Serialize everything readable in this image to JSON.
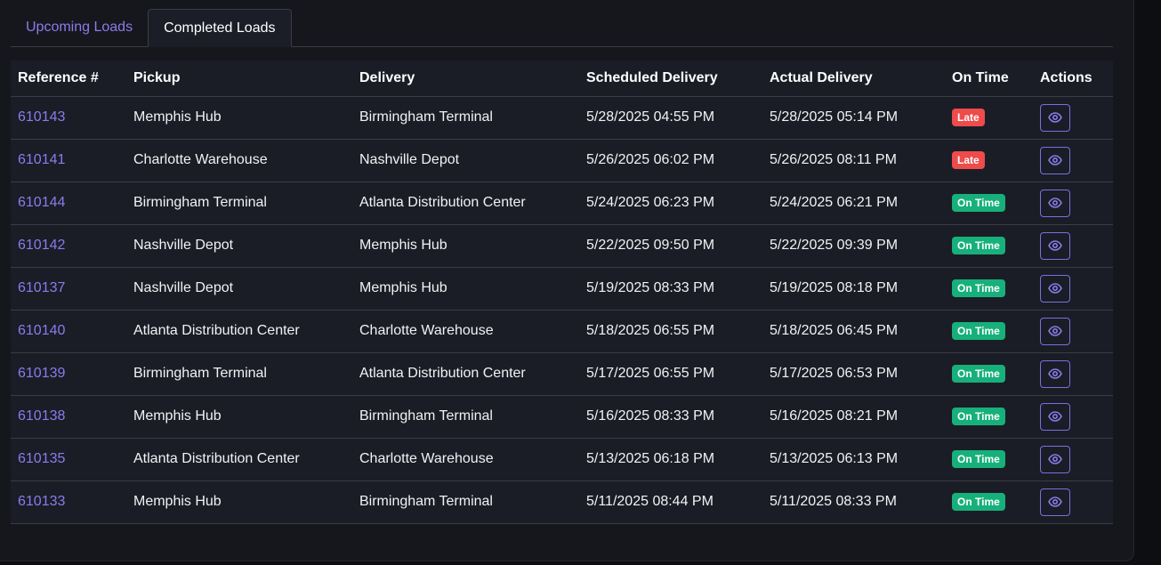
{
  "tabs": [
    {
      "label": "Upcoming Loads",
      "active": false
    },
    {
      "label": "Completed Loads",
      "active": true
    }
  ],
  "table": {
    "headers": [
      "Reference #",
      "Pickup",
      "Delivery",
      "Scheduled Delivery",
      "Actual Delivery",
      "On Time",
      "Actions"
    ],
    "action_icon": "eye-icon",
    "rows": [
      {
        "ref": "610143",
        "pickup": "Memphis Hub",
        "delivery": "Birmingham Terminal",
        "scheduled": "5/28/2025 04:55 PM",
        "actual": "5/28/2025 05:14 PM",
        "status": "Late"
      },
      {
        "ref": "610141",
        "pickup": "Charlotte Warehouse",
        "delivery": "Nashville Depot",
        "scheduled": "5/26/2025 06:02 PM",
        "actual": "5/26/2025 08:11 PM",
        "status": "Late"
      },
      {
        "ref": "610144",
        "pickup": "Birmingham Terminal",
        "delivery": "Atlanta Distribution Center",
        "scheduled": "5/24/2025 06:23 PM",
        "actual": "5/24/2025 06:21 PM",
        "status": "On Time"
      },
      {
        "ref": "610142",
        "pickup": "Nashville Depot",
        "delivery": "Memphis Hub",
        "scheduled": "5/22/2025 09:50 PM",
        "actual": "5/22/2025 09:39 PM",
        "status": "On Time"
      },
      {
        "ref": "610137",
        "pickup": "Nashville Depot",
        "delivery": "Memphis Hub",
        "scheduled": "5/19/2025 08:33 PM",
        "actual": "5/19/2025 08:18 PM",
        "status": "On Time"
      },
      {
        "ref": "610140",
        "pickup": "Atlanta Distribution Center",
        "delivery": "Charlotte Warehouse",
        "scheduled": "5/18/2025 06:55 PM",
        "actual": "5/18/2025 06:45 PM",
        "status": "On Time"
      },
      {
        "ref": "610139",
        "pickup": "Birmingham Terminal",
        "delivery": "Atlanta Distribution Center",
        "scheduled": "5/17/2025 06:55 PM",
        "actual": "5/17/2025 06:53 PM",
        "status": "On Time"
      },
      {
        "ref": "610138",
        "pickup": "Memphis Hub",
        "delivery": "Birmingham Terminal",
        "scheduled": "5/16/2025 08:33 PM",
        "actual": "5/16/2025 08:21 PM",
        "status": "On Time"
      },
      {
        "ref": "610135",
        "pickup": "Atlanta Distribution Center",
        "delivery": "Charlotte Warehouse",
        "scheduled": "5/13/2025 06:18 PM",
        "actual": "5/13/2025 06:13 PM",
        "status": "On Time"
      },
      {
        "ref": "610133",
        "pickup": "Memphis Hub",
        "delivery": "Birmingham Terminal",
        "scheduled": "5/11/2025 08:44 PM",
        "actual": "5/11/2025 08:33 PM",
        "status": "On Time"
      }
    ]
  },
  "colors": {
    "accent": "#8b7bec",
    "late": "#ee4b4b",
    "on_time": "#17b07a",
    "panel_bg": "#15171c",
    "table_bg": "#1a1d26"
  }
}
